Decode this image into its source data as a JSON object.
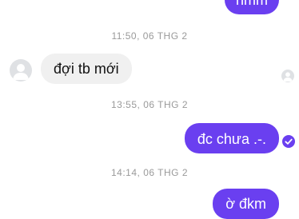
{
  "messages": {
    "top_out": "hmm",
    "ts1": "11:50, 06 THG 2",
    "in1": "đợi  tb mới",
    "ts2": "13:55, 06 THG 2",
    "out2": "đc chưa .-.",
    "ts3": "14:14, 06 THG 2",
    "out3": "ờ đkm"
  },
  "colors": {
    "outgoing_bubble": "#6a3ff0",
    "incoming_bubble": "#f0f0f0",
    "timestamp": "#9a9a9a"
  },
  "icons": {
    "contact_avatar": "avatar-icon",
    "seen_avatar": "avatar-icon",
    "delivered": "check-circle-icon"
  }
}
